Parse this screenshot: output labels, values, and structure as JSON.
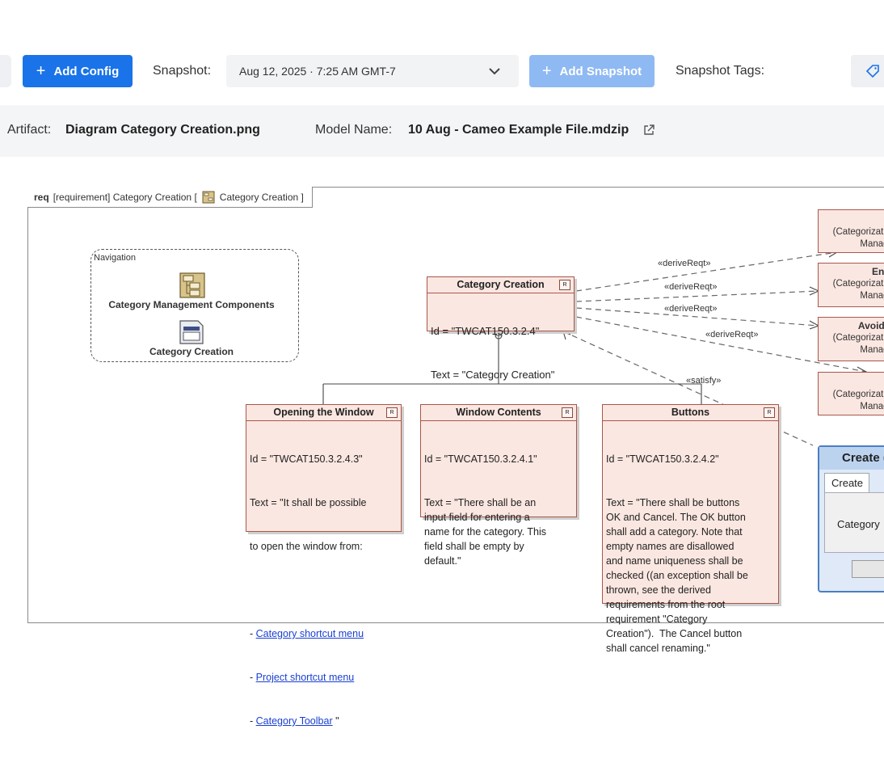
{
  "toolbar": {
    "add_config_label": "Add Config",
    "snapshot_label": "Snapshot:",
    "snapshot_value": "Aug 12, 2025 · 7:25 AM GMT-7",
    "add_snapshot_label": "Add Snapshot",
    "snapshot_tags_label": "Snapshot Tags:"
  },
  "info": {
    "artifact_label": "Artifact:",
    "artifact_value": "Diagram Category Creation.png",
    "model_label": "Model Name:",
    "model_value": "10 Aug - Cameo Example File.mdzip"
  },
  "diagram": {
    "frame_kind": "req",
    "frame_title_a": "[requirement] Category Creation [",
    "frame_title_b": "Category Creation ]",
    "navigation": {
      "title": "Navigation",
      "item1": "Category Management Components",
      "item2": "Category Creation"
    },
    "main_req": {
      "title": "Category Creation",
      "id": "Id = \"TWCAT150.3.2.4\"",
      "text": "Text = \"Category Creation\""
    },
    "req_open": {
      "title": "Opening the Window",
      "id": "Id = \"TWCAT150.3.2.4.3\"",
      "text1": "Text = \"It shall be possible",
      "text2": "to open the window from:",
      "link1": "Category shortcut menu",
      "link2": "Project shortcut menu",
      "link3": "Category Toolbar",
      "end": " \""
    },
    "req_contents": {
      "title": "Window Contents",
      "id": "Id = \"TWCAT150.3.2.4.1\"",
      "text": "Text = \"There shall be an\ninput field for entering a\nname for the category. This\nfield shall be empty by\ndefault.\""
    },
    "req_buttons": {
      "title": "Buttons",
      "id": "Id = \"TWCAT150.3.2.4.2\"",
      "text": "Text = \"There shall be buttons\nOK and Cancel. The OK button\nshall add a category. Note that\nempty names are disallowed\nand name uniqueness shall be\nchecked ((an exception shall be\nthrown, see the derived\nrequirements from the root\nrequirement \"Category\nCreation\").  The Cancel button\nshall cancel renaming.\""
    },
    "edge_labels": [
      "«deriveReqt»",
      "«deriveReqt»",
      "«deriveReqt»",
      "«deriveReqt»",
      "«satisfy»"
    ],
    "right_boxes": [
      {
        "title": "",
        "line1": "(Categorizat",
        "line2": "Manag"
      },
      {
        "title": "Ens",
        "line1": "(Categorizat",
        "line2": "Manag"
      },
      {
        "title": "Avoidi",
        "line1": "(Categorizat",
        "line2": "Manag"
      },
      {
        "title": "",
        "line1": "(Categorizat",
        "line2": "Manag"
      }
    ],
    "create_window": {
      "title": "Create (",
      "tab": "Create",
      "field_label": "Category"
    }
  },
  "colors": {
    "primary": "#1a73e8",
    "primary_disabled": "#8fb9f2",
    "requirement_fill": "#fbe7e1",
    "requirement_border": "#a8574a"
  },
  "icons": [
    "plus-icon",
    "chevron-down-icon",
    "tag-icon",
    "external-link-icon",
    "package-icon",
    "diagram-icon"
  ]
}
